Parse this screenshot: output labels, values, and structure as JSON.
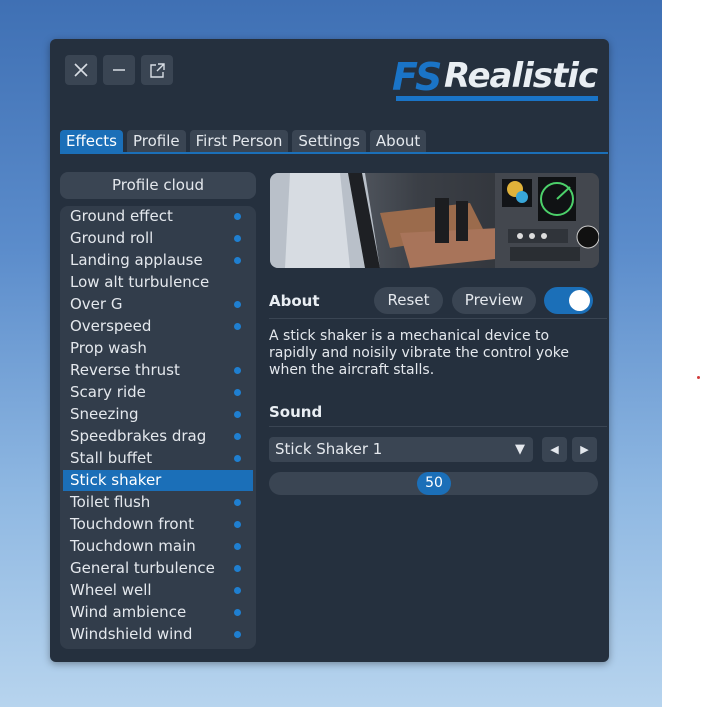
{
  "logo": {
    "fs": "FS",
    "text": "Realistic"
  },
  "tabs": [
    {
      "label": "Effects",
      "active": true
    },
    {
      "label": "Profile",
      "active": false
    },
    {
      "label": "First Person",
      "active": false
    },
    {
      "label": "Settings",
      "active": false
    },
    {
      "label": "About",
      "active": false
    }
  ],
  "sidebar": {
    "profile_cloud_label": "Profile cloud",
    "effects": [
      {
        "label": "Ground effect",
        "enabled": true
      },
      {
        "label": "Ground roll",
        "enabled": true
      },
      {
        "label": "Landing applause",
        "enabled": true
      },
      {
        "label": "Low alt turbulence",
        "enabled": false
      },
      {
        "label": "Over G",
        "enabled": true
      },
      {
        "label": "Overspeed",
        "enabled": true
      },
      {
        "label": "Prop wash",
        "enabled": false
      },
      {
        "label": "Reverse thrust",
        "enabled": true
      },
      {
        "label": "Scary ride",
        "enabled": true
      },
      {
        "label": "Sneezing",
        "enabled": true
      },
      {
        "label": "Speedbrakes drag",
        "enabled": true
      },
      {
        "label": "Stall buffet",
        "enabled": true
      },
      {
        "label": "Stick shaker",
        "enabled": true,
        "selected": true
      },
      {
        "label": "Toilet flush",
        "enabled": true
      },
      {
        "label": "Touchdown front",
        "enabled": true
      },
      {
        "label": "Touchdown main",
        "enabled": true
      },
      {
        "label": "General turbulence",
        "enabled": true
      },
      {
        "label": "Wheel well",
        "enabled": true
      },
      {
        "label": "Wind ambience",
        "enabled": true
      },
      {
        "label": "Windshield wind",
        "enabled": true
      }
    ]
  },
  "detail": {
    "about_title": "About",
    "reset_label": "Reset",
    "preview_label": "Preview",
    "enabled": true,
    "description": "A stick shaker is a mechanical device to rapidly and noisily vibrate the control yoke when the aircraft stalls.",
    "sound_title": "Sound",
    "sound_selected": "Stick Shaker 1",
    "volume": 50,
    "volume_max": 100
  },
  "icons": {
    "close": "close-icon",
    "minimize": "minimize-icon",
    "popout": "popout-icon",
    "dropdown": "caret-down-icon",
    "prev": "caret-left-icon",
    "next": "caret-right-icon"
  },
  "colors": {
    "accent": "#1b6fb8",
    "panel": "#25303e",
    "control": "#3a4553",
    "dot": "#1f7fd0"
  }
}
